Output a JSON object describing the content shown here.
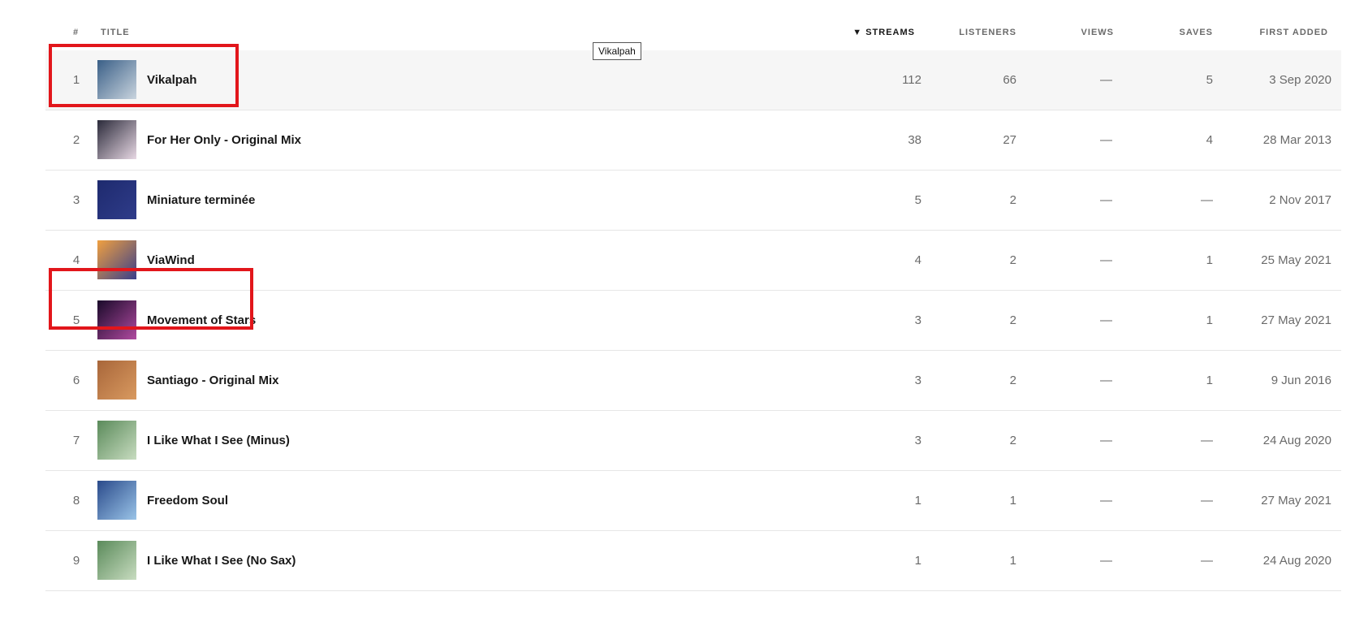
{
  "header": {
    "num": "#",
    "title": "TITLE",
    "streams": "▼ STREAMS",
    "listeners": "LISTENERS",
    "views": "VIEWS",
    "saves": "SAVES",
    "first_added": "FIRST ADDED"
  },
  "tooltip": "Vikalpah",
  "rows": [
    {
      "num": "1",
      "title": "Vikalpah",
      "streams": "112",
      "listeners": "66",
      "views": "—",
      "saves": "5",
      "first_added": "3 Sep 2020",
      "art": [
        "#3a5f87",
        "#c9d4de"
      ]
    },
    {
      "num": "2",
      "title": "For Her Only - Original Mix",
      "streams": "38",
      "listeners": "27",
      "views": "—",
      "saves": "4",
      "first_added": "28 Mar 2013",
      "art": [
        "#2a2a3a",
        "#e8d8e4"
      ]
    },
    {
      "num": "3",
      "title": "Miniature terminée",
      "streams": "5",
      "listeners": "2",
      "views": "—",
      "saves": "—",
      "first_added": "2 Nov 2017",
      "art": [
        "#1e2a6e",
        "#2f3c8a"
      ]
    },
    {
      "num": "4",
      "title": "ViaWind",
      "streams": "4",
      "listeners": "2",
      "views": "—",
      "saves": "1",
      "first_added": "25 May 2021",
      "art": [
        "#f0a040",
        "#3a3f8a"
      ]
    },
    {
      "num": "5",
      "title": "Movement of Stars",
      "streams": "3",
      "listeners": "2",
      "views": "—",
      "saves": "1",
      "first_added": "27 May 2021",
      "art": [
        "#1a0a2a",
        "#b04aa0"
      ]
    },
    {
      "num": "6",
      "title": "Santiago - Original Mix",
      "streams": "3",
      "listeners": "2",
      "views": "—",
      "saves": "1",
      "first_added": "9 Jun 2016",
      "art": [
        "#a8663a",
        "#d99a60"
      ]
    },
    {
      "num": "7",
      "title": "I Like What I See (Minus)",
      "streams": "3",
      "listeners": "2",
      "views": "—",
      "saves": "—",
      "first_added": "24 Aug 2020",
      "art": [
        "#5a8a5a",
        "#c8dcc0"
      ]
    },
    {
      "num": "8",
      "title": "Freedom Soul",
      "streams": "1",
      "listeners": "1",
      "views": "—",
      "saves": "—",
      "first_added": "27 May 2021",
      "art": [
        "#2a4a8a",
        "#9ac4e8"
      ]
    },
    {
      "num": "9",
      "title": "I Like What I See (No Sax)",
      "streams": "1",
      "listeners": "1",
      "views": "—",
      "saves": "—",
      "first_added": "24 Aug 2020",
      "art": [
        "#5a8a5a",
        "#c8dcc0"
      ]
    }
  ]
}
